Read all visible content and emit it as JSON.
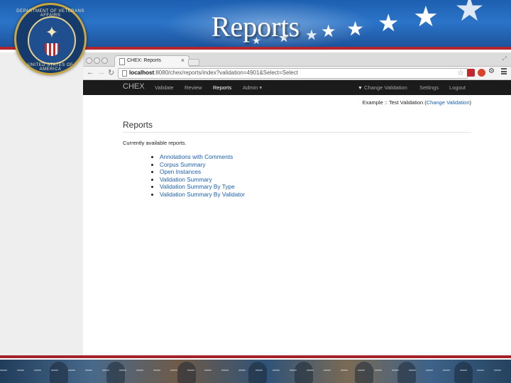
{
  "slide": {
    "title": "Reports"
  },
  "seal": {
    "top_text": "DEPARTMENT OF VETERANS AFFAIRS",
    "bottom_text": "UNITED STATES OF AMERICA"
  },
  "browser": {
    "tab_title": "CHEX: Reports",
    "url_host": "localhost",
    "url_path": ":8080/chex/reports/index?validation=4901&Select=Select"
  },
  "navbar": {
    "brand": "CHEX",
    "validate": "Validate",
    "review": "Review",
    "reports": "Reports",
    "admin": "Admin ▾",
    "change_validation": "Change Validation",
    "settings": "Settings",
    "logout": "Logout"
  },
  "page": {
    "context_prefix": "Example :: Test Validation (",
    "context_link": "Change Validation",
    "context_suffix": ")",
    "heading": "Reports",
    "intro": "Currently available reports.",
    "reports": [
      "Annotations with Comments",
      "Corpus Summary",
      "Open Instances",
      "Validation Summary",
      "Validation Summary By Type",
      "Validation Summary By Validator"
    ]
  },
  "colors": {
    "slide_blue": "#1d5fb0",
    "stripe_red": "#b3262d",
    "navbar_bg": "#1b1b1b",
    "link_blue": "#1a5fb4"
  },
  "icons": {
    "back": "arrow-left-icon",
    "forward": "arrow-right-icon",
    "reload": "reload-icon",
    "bookmark": "star-icon",
    "menu": "hamburger-menu-icon"
  }
}
